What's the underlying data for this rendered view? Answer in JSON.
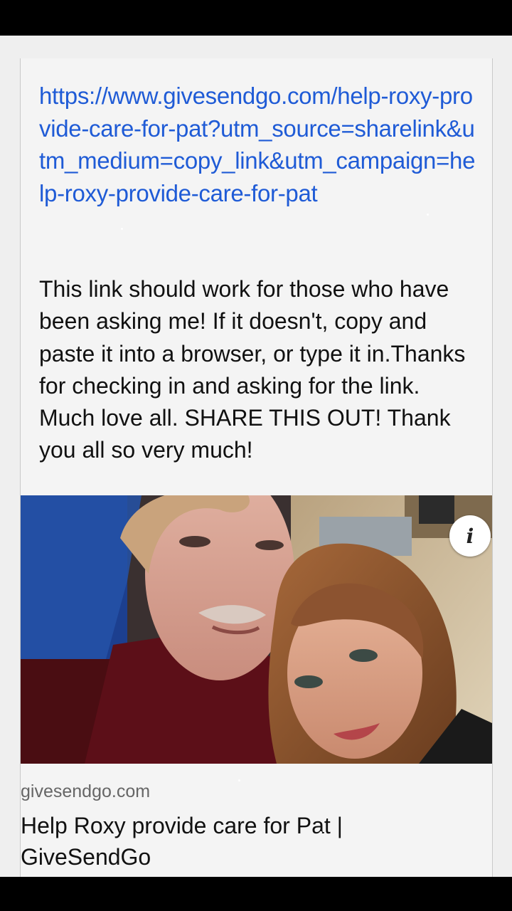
{
  "post": {
    "link_url": "https://www.givesendgo.com/help-roxy-provide-care-for-pat?utm_source=sharelink&utm_medium=copy_link&utm_campaign=help-roxy-provide-care-for-pat",
    "message": "This link should work for those who have been asking me! If it doesn't, copy and paste it into a browser, or type it in.Thanks for checking in and asking for the link. Much love all. SHARE THIS OUT! Thank you all so very much!"
  },
  "link_preview": {
    "image_icon": "info-icon",
    "domain": "givesendgo.com",
    "title": "Help Roxy provide care for Pat | GiveSendGo"
  },
  "colors": {
    "link": "#1f5bd6",
    "background": "#efefef",
    "text": "#111111",
    "domain_text": "#666666"
  }
}
